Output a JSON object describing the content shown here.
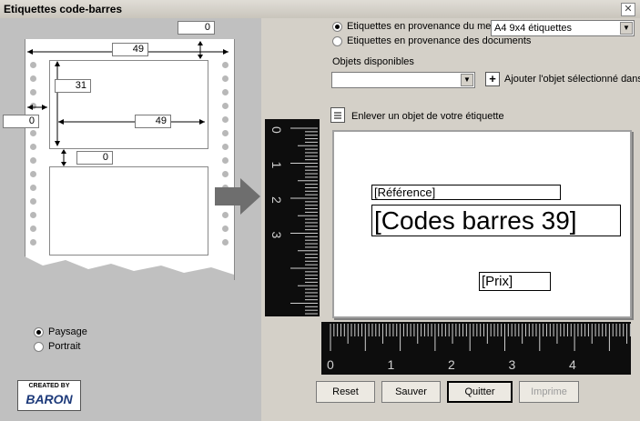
{
  "window": {
    "title": "Etiquettes code-barres",
    "close_glyph": "✕"
  },
  "layout_editor": {
    "top_margin": "0",
    "label_width": "49",
    "label_height": "31",
    "left_margin": "0",
    "h_gap_width": "49",
    "v_gap": "0"
  },
  "orientation": {
    "landscape_label": "Paysage",
    "portrait_label": "Portrait",
    "selected": "landscape"
  },
  "logo": {
    "line1": "CREATED BY",
    "line2": "BARON"
  },
  "source": {
    "option_merchandise": "Etiquettes en provenance du mer",
    "option_documents": "Etiquettes en provenance des documents",
    "format_value": "A4 9x4 étiquettes"
  },
  "objects": {
    "label": "Objets disponibles",
    "select_value": "",
    "add_label": "Ajouter l'objet sélectionné dans",
    "remove_label": "Enlever un objet de votre étiquette"
  },
  "preview": {
    "reference": "[Référence]",
    "barcode": "[Codes barres 39]",
    "price": "[Prix]"
  },
  "ruler": {
    "vertical_marks": [
      "0",
      "1",
      "2",
      "3"
    ],
    "horizontal_marks": [
      "0",
      "1",
      "2",
      "3",
      "4"
    ]
  },
  "buttons": {
    "reset": "Reset",
    "save": "Sauver",
    "quit": "Quitter",
    "print": "Imprime"
  }
}
